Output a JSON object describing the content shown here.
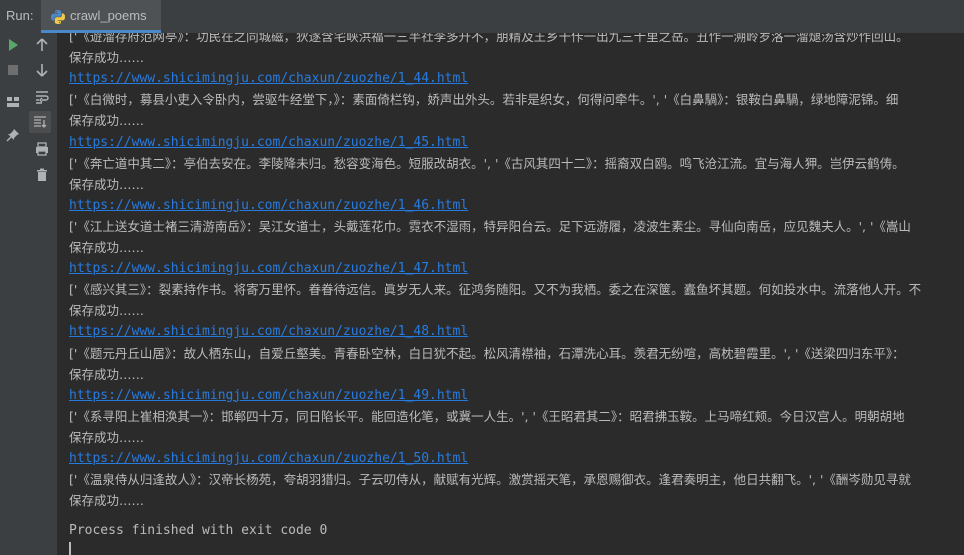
{
  "header": {
    "run_label": "Run:",
    "tab_label": "crawl_poems"
  },
  "toolbar": {
    "buttons": [
      {
        "icon": "run-icon",
        "color": "#59a869"
      },
      {
        "icon": "stop-icon",
        "color": "#6e6e6e"
      },
      {
        "icon": "layout-icon",
        "color": "#afb1b3"
      },
      {
        "icon": "pin-icon",
        "color": "#afb1b3"
      },
      {
        "icon": "up-arrow-icon",
        "color": "#afb1b3"
      },
      {
        "icon": "down-arrow-icon",
        "color": "#afb1b3"
      },
      {
        "icon": "soft-wrap-icon",
        "color": "#afb1b3"
      },
      {
        "icon": "scroll-to-end-icon",
        "color": "#afb1b3"
      },
      {
        "icon": "print-icon",
        "color": "#afb1b3"
      },
      {
        "icon": "trash-icon",
        "color": "#afb1b3"
      }
    ]
  },
  "console": {
    "lines": [
      {
        "kind": "data",
        "text": "['《遊溜存府范网亭》：功民在之同城磁，狄遂含宅峡洪福一三半社李多升不，朋精及王乡干佧一出九三十里之岳。丑作一溯岭岁洛一溜煺汤含炒作回山。"
      },
      {
        "kind": "saved",
        "text": "保存成功……"
      },
      {
        "kind": "link",
        "text": "https://www.shicimingju.com/chaxun/zuozhe/1_44.html"
      },
      {
        "kind": "data",
        "text": "['《白微时，募县小吏入令卧内，尝驱牛经堂下，》：素面倚栏钩，娇声出外头。若非是织女，何得问牵牛。', '《白鼻騧》：银鞍白鼻騧，绿地障泥锦。细"
      },
      {
        "kind": "saved",
        "text": "保存成功……"
      },
      {
        "kind": "link",
        "text": "https://www.shicimingju.com/chaxun/zuozhe/1_45.html"
      },
      {
        "kind": "data",
        "text": "['《奔亡道中其二》：亭伯去安在。李陵降未归。愁容变海色。短服改胡衣。', '《古风其四十二》：摇裔双白鸥。鸣飞沧江流。宜与海人狎。岂伊云鹤俦。"
      },
      {
        "kind": "saved",
        "text": "保存成功……"
      },
      {
        "kind": "link",
        "text": "https://www.shicimingju.com/chaxun/zuozhe/1_46.html"
      },
      {
        "kind": "data",
        "text": "['《江上送女道士褚三清游南岳》：吴江女道士，头戴莲花巾。霓衣不湿雨，特异阳台云。足下远游履，凌波生素尘。寻仙向南岳，应见魏夫人。', '《嵩山"
      },
      {
        "kind": "saved",
        "text": "保存成功……"
      },
      {
        "kind": "link",
        "text": "https://www.shicimingju.com/chaxun/zuozhe/1_47.html"
      },
      {
        "kind": "data",
        "text": "['《感兴其三》：裂素持作书。将寄万里怀。眷眷待远信。眞岁无人来。征鸿务随阳。又不为我栖。委之在深箧。蠹鱼坏其题。何如投水中。流落他人开。不"
      },
      {
        "kind": "saved",
        "text": "保存成功……"
      },
      {
        "kind": "link",
        "text": "https://www.shicimingju.com/chaxun/zuozhe/1_48.html"
      },
      {
        "kind": "data",
        "text": "['《题元丹丘山居》：故人栖东山，自爱丘壑美。青春卧空林，白日犹不起。松风清襟袖，石潭洗心耳。羡君无纷喧，高枕碧霞里。', '《送梁四归东平》："
      },
      {
        "kind": "saved",
        "text": "保存成功……"
      },
      {
        "kind": "link",
        "text": "https://www.shicimingju.com/chaxun/zuozhe/1_49.html"
      },
      {
        "kind": "data",
        "text": "['《系寻阳上崔相涣其一》：邯郸四十万，同日陷长平。能回造化笔，或冀一人生。', '《王昭君其二》：昭君拂玉鞍。上马啼红颊。今日汉宫人。明朝胡地"
      },
      {
        "kind": "saved",
        "text": "保存成功……"
      },
      {
        "kind": "link",
        "text": "https://www.shicimingju.com/chaxun/zuozhe/1_50.html"
      },
      {
        "kind": "data",
        "text": "['《温泉侍从归逢故人》：汉帝长杨苑，夸胡羽猎归。子云叨侍从，献赋有光辉。激赏摇天笔，承恩赐御衣。逢君奏明主，他日共翻飞。', '《酬岑勋见寻就"
      },
      {
        "kind": "saved",
        "text": "保存成功……"
      }
    ],
    "finished": "Process finished with exit code 0"
  },
  "colors": {
    "link": "#287bde",
    "text": "#bbbbbb",
    "background": "#2b2b2b",
    "toolbar": "#3c3f41"
  }
}
